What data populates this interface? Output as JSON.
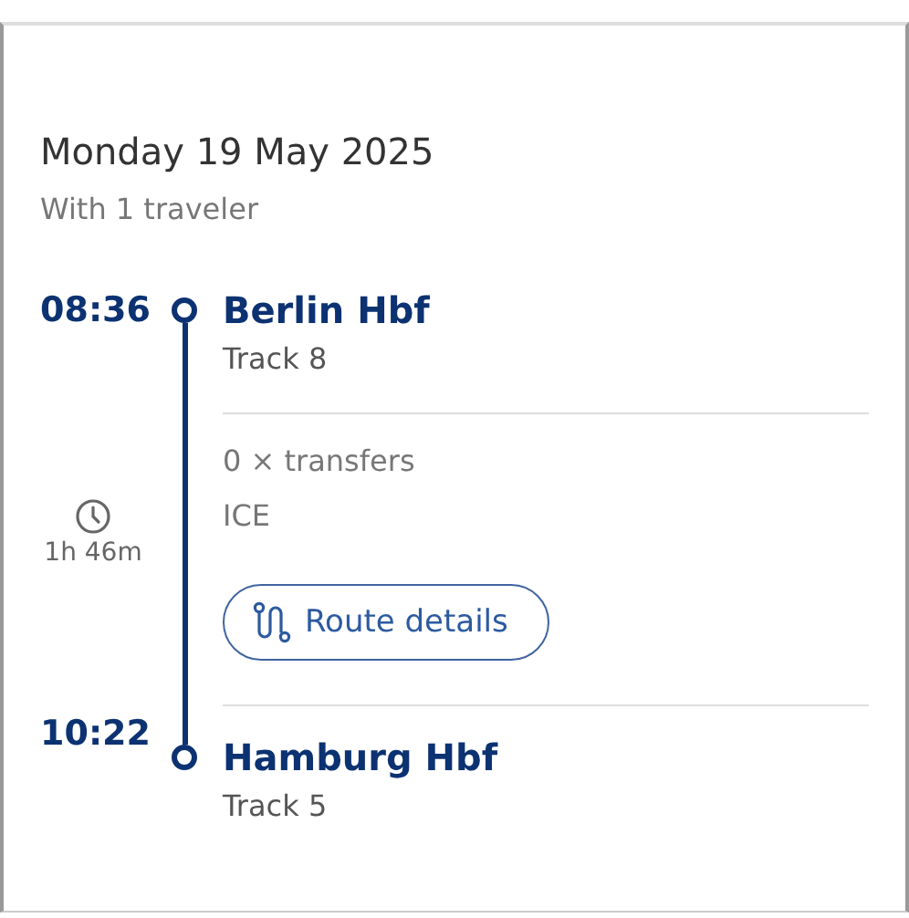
{
  "date": "Monday 19 May 2025",
  "travelers": "With 1 traveler",
  "departure": {
    "time": "08:36",
    "station": "Berlin Hbf",
    "track": "Track 8"
  },
  "duration": "1h 46m",
  "transfers": "0 × transfers",
  "train": "ICE",
  "route_button": "Route details",
  "arrival": {
    "time": "10:22",
    "station": "Hamburg Hbf",
    "track": "Track 5"
  }
}
